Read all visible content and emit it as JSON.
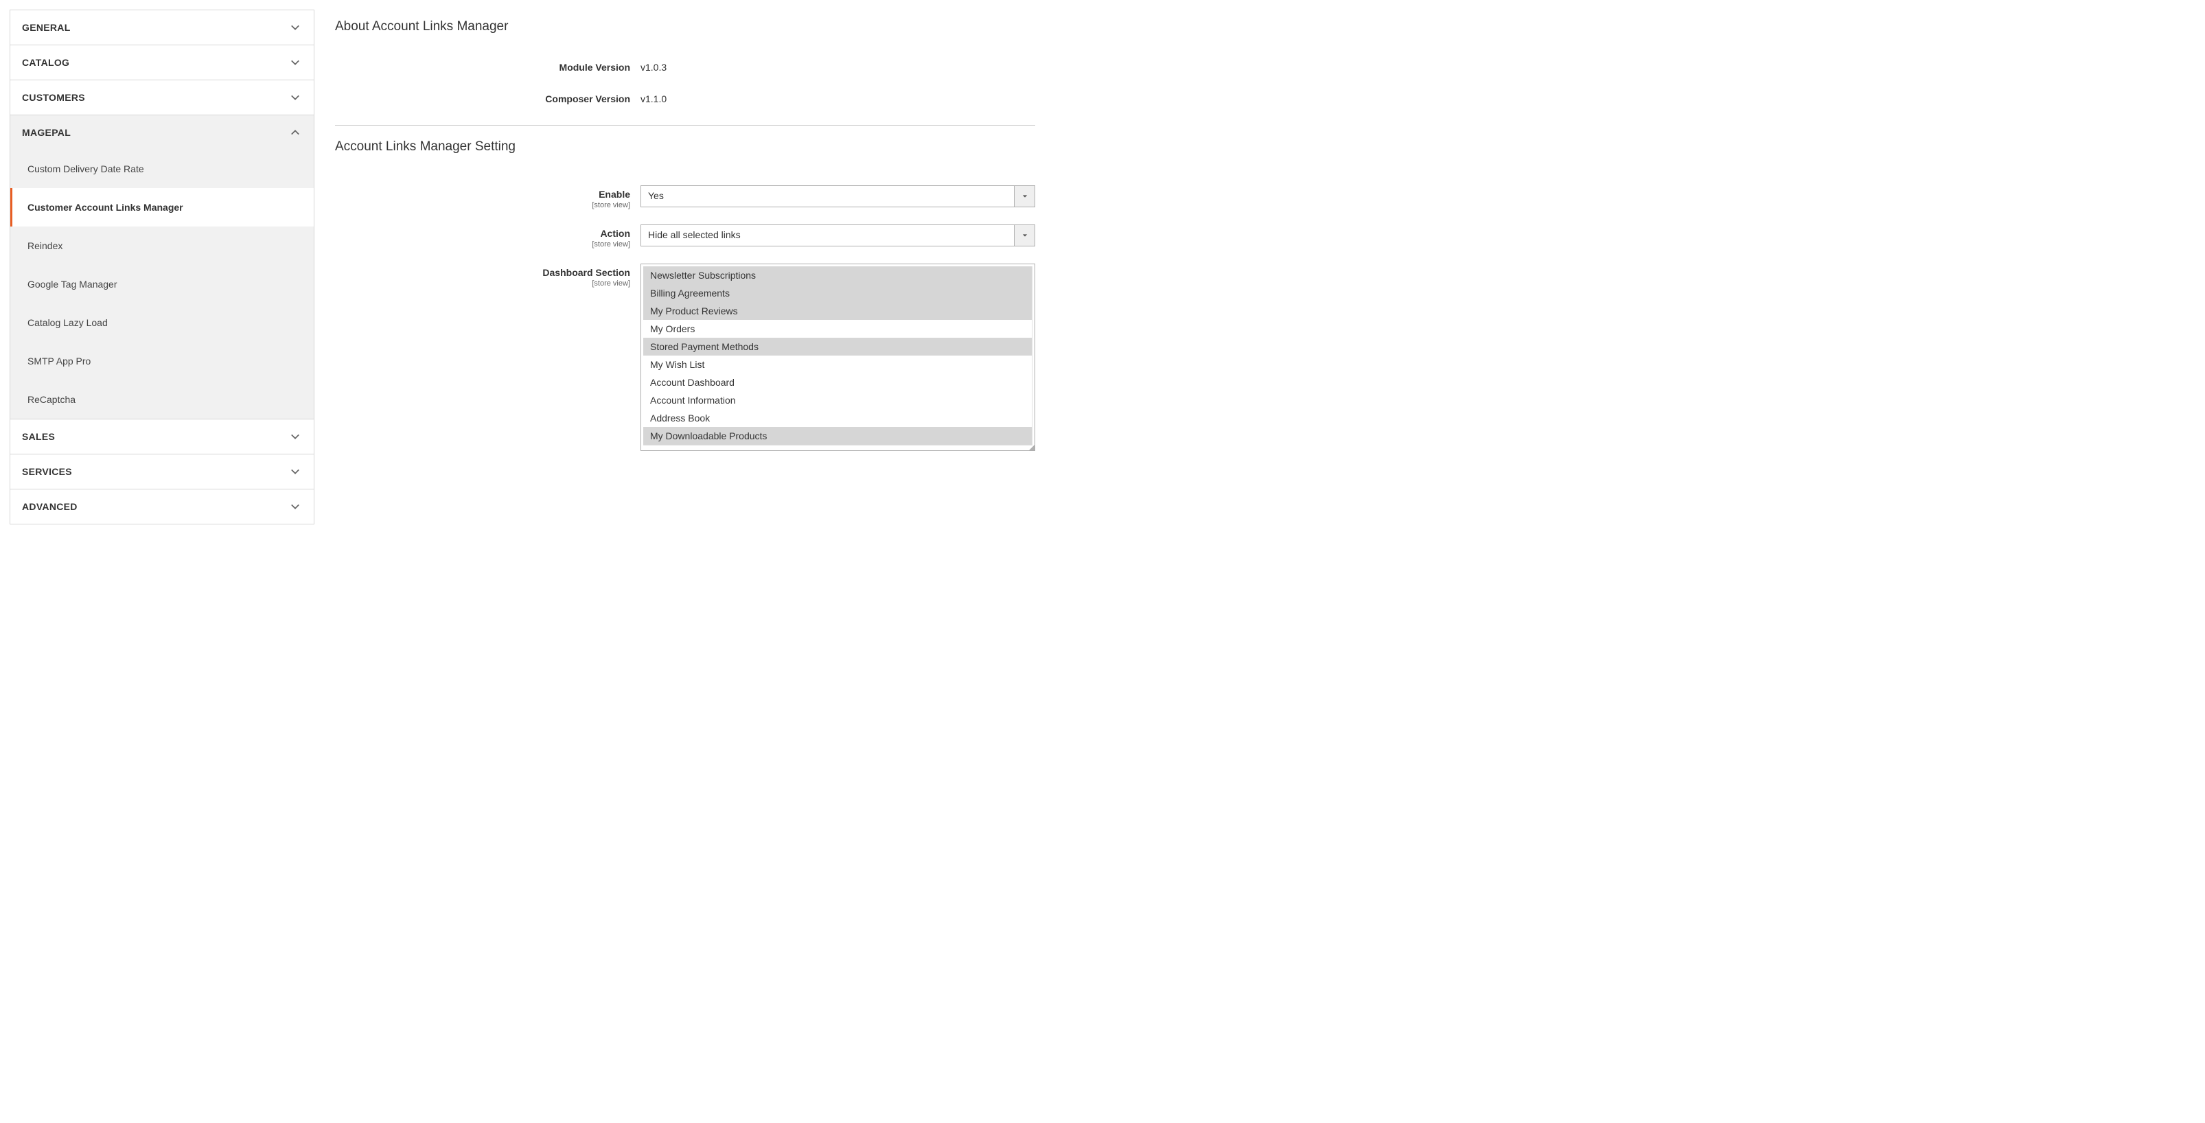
{
  "sidebar": {
    "sections": [
      {
        "label": "GENERAL",
        "expanded": false
      },
      {
        "label": "CATALOG",
        "expanded": false
      },
      {
        "label": "CUSTOMERS",
        "expanded": false
      },
      {
        "label": "MAGEPAL",
        "expanded": true
      },
      {
        "label": "SALES",
        "expanded": false
      },
      {
        "label": "SERVICES",
        "expanded": false
      },
      {
        "label": "ADVANCED",
        "expanded": false
      }
    ],
    "magepal_items": [
      {
        "label": "Custom Delivery Date Rate",
        "active": false
      },
      {
        "label": "Customer Account Links Manager",
        "active": true
      },
      {
        "label": "Reindex",
        "active": false
      },
      {
        "label": "Google Tag Manager",
        "active": false
      },
      {
        "label": "Catalog Lazy Load",
        "active": false
      },
      {
        "label": "SMTP App Pro",
        "active": false
      },
      {
        "label": "ReCaptcha",
        "active": false
      }
    ]
  },
  "main": {
    "about_title": "About Account Links Manager",
    "module_version_label": "Module Version",
    "module_version_value": "v1.0.3",
    "composer_version_label": "Composer Version",
    "composer_version_value": "v1.1.0",
    "settings_title": "Account Links Manager Setting",
    "scope_label": "[store view]",
    "enable_label": "Enable",
    "enable_value": "Yes",
    "action_label": "Action",
    "action_value": "Hide all selected links",
    "dashboard_label": "Dashboard Section",
    "dashboard_options": [
      {
        "label": "Newsletter Subscriptions",
        "selected": true
      },
      {
        "label": "Billing Agreements",
        "selected": true
      },
      {
        "label": "My Product Reviews",
        "selected": true
      },
      {
        "label": "My Orders",
        "selected": false
      },
      {
        "label": "Stored Payment Methods",
        "selected": true
      },
      {
        "label": "My Wish List",
        "selected": false
      },
      {
        "label": "Account Dashboard",
        "selected": false
      },
      {
        "label": "Account Information",
        "selected": false
      },
      {
        "label": "Address Book",
        "selected": false
      },
      {
        "label": "My Downloadable Products",
        "selected": true
      }
    ]
  }
}
